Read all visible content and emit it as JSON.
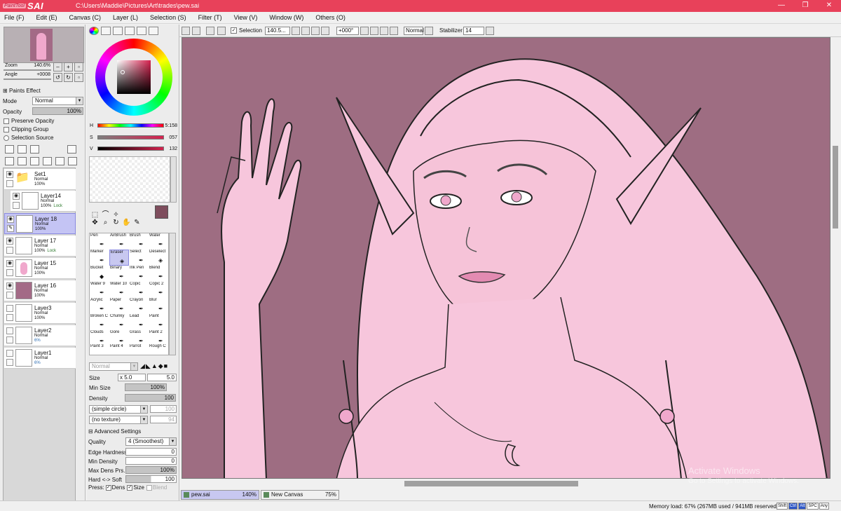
{
  "app": {
    "logo_small": "PaintTool",
    "logo_big": "SAI",
    "path": "C:\\Users\\Maddie\\Pictures\\Art\\trades\\pew.sai",
    "min_icon": "—",
    "max_icon": "❐",
    "close_icon": "✕"
  },
  "menu": [
    "File (F)",
    "Edit (E)",
    "Canvas (C)",
    "Layer (L)",
    "Selection (S)",
    "Filter (T)",
    "View (V)",
    "Window (W)",
    "Others (O)"
  ],
  "navigator": {
    "zoom_label": "Zoom",
    "zoom_value": "140.6%",
    "angle_label": "Angle",
    "angle_value": "+0008"
  },
  "layer_props": {
    "paints_effect": "Paints Effect",
    "mode_label": "Mode",
    "mode_value": "Normal",
    "opacity_label": "Opacity",
    "opacity_value": "100%",
    "preserve_opacity": "Preserve Opacity",
    "clipping_group": "Clipping Group",
    "selection_source": "Selection Source"
  },
  "layers": [
    {
      "name": "Set1",
      "mode": "Normal",
      "opacity": "100%",
      "lock": "",
      "selected": false
    },
    {
      "name": "Layer14",
      "mode": "Normal",
      "opacity": "100%",
      "lock": "Lock",
      "selected": false
    },
    {
      "name": "Layer 18",
      "mode": "Normal",
      "opacity": "100%",
      "lock": "",
      "selected": true
    },
    {
      "name": "Layer 17",
      "mode": "Normal",
      "opacity": "100%",
      "lock": "Lock",
      "selected": false
    },
    {
      "name": "Layer 15",
      "mode": "Normal",
      "opacity": "100%",
      "lock": "",
      "selected": false
    },
    {
      "name": "Layer 16",
      "mode": "Normal",
      "opacity": "100%",
      "lock": "",
      "selected": false
    },
    {
      "name": "Layer3",
      "mode": "Normal",
      "opacity": "100%",
      "lock": "",
      "selected": false
    },
    {
      "name": "Layer2",
      "mode": "Normal",
      "opacity": "6%",
      "lock": "",
      "selected": false
    },
    {
      "name": "Layer1",
      "mode": "Normal",
      "opacity": "6%",
      "lock": "",
      "selected": false
    }
  ],
  "color": {
    "h_label": "H",
    "h_value": "5:158",
    "s_label": "S",
    "s_value": "057",
    "v_label": "V",
    "v_value": "132",
    "current": "#7e4d5d"
  },
  "tools": [
    "Pen",
    "AirBrush",
    "Brush",
    "Water",
    "Marker",
    "Eraser",
    "Select",
    "Deselect",
    "Bucket",
    "Binary",
    "Ink Pen",
    "Blend",
    "Water 9",
    "Water 10",
    "Copic",
    "Copic 2",
    "Acrylic",
    "Paper",
    "Crayon",
    "Blur",
    "Broken C",
    "Chunky",
    "Lead",
    "Paint",
    "Clouds",
    "Gore",
    "Grass",
    "Paint 2",
    "Paint 3",
    "Paint 4",
    "Parrot",
    "Rough C"
  ],
  "brush": {
    "blend_mode": "Normal",
    "size_label": "Size",
    "size_mult": "x 5.0",
    "size_value": "5.0",
    "min_size_label": "Min Size",
    "min_size_value": "100%",
    "density_label": "Density",
    "density_value": "100",
    "shape_value": "(simple circle)",
    "shape_num": "100",
    "texture_value": "(no texture)",
    "texture_num": "94",
    "advanced": "Advanced Settings",
    "quality_label": "Quality",
    "quality_value": "4 (Smoothest)",
    "edge_label": "Edge Hardness",
    "edge_value": "0",
    "min_density_label": "Min Density",
    "min_density_value": "0",
    "max_dens_label": "Max Dens Prs.",
    "max_dens_value": "100%",
    "hard_soft_label": "Hard <-> Soft",
    "hard_soft_value": "100",
    "press_label": "Press:",
    "press_dens": "Dens",
    "press_size": "Size",
    "press_blend": "Blend"
  },
  "toolbar": {
    "selection_label": "Selection",
    "zoom_value": "140.5...",
    "angle_value": "+000°",
    "blend_value": "Normal",
    "stabilizer_label": "Stabilizer",
    "stabilizer_value": "14"
  },
  "watermark": {
    "title": "Activate Windows",
    "subtitle": "Go to Settings to activate Windows."
  },
  "doc_tabs": [
    {
      "name": "pew.sai",
      "zoom": "140%"
    },
    {
      "name": "New Canvas",
      "zoom": "75%"
    }
  ],
  "status": {
    "memory": "Memory load: 67% (267MB used / 941MB reserved)",
    "keys": [
      "Shift",
      "Ctrl",
      "Alt",
      "SPC",
      "Any"
    ]
  }
}
